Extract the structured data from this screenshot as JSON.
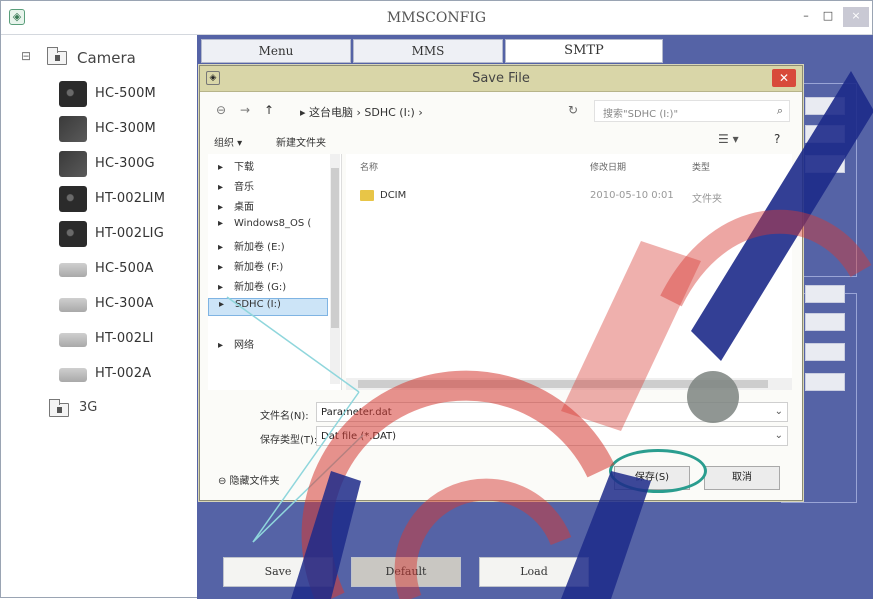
{
  "window": {
    "title": "MMSCONFIG",
    "icon": "app-icon",
    "min": "–",
    "max": "□",
    "close": "×"
  },
  "tree": {
    "root_label": "Camera",
    "root_expander": "⊟",
    "cameras": [
      {
        "label": "HC-500M",
        "thumb": "dark"
      },
      {
        "label": "HC-300M",
        "thumb": "mid"
      },
      {
        "label": "HC-300G",
        "thumb": "mid"
      },
      {
        "label": "HT-002LIM",
        "thumb": "dark"
      },
      {
        "label": "HT-002LIG",
        "thumb": "dark"
      },
      {
        "label": "HC-500A",
        "thumb": "pale"
      },
      {
        "label": "HC-300A",
        "thumb": "pale"
      },
      {
        "label": "HT-002LI",
        "thumb": "pale"
      },
      {
        "label": "HT-002A",
        "thumb": "pale"
      }
    ],
    "g3_label": "3G"
  },
  "tabs": [
    "Menu",
    "MMS",
    "SMTP"
  ],
  "bottom_buttons": [
    "Save",
    "Default",
    "Load"
  ],
  "dialog": {
    "title": "Save File",
    "address": {
      "back": "⊖",
      "forward": "→",
      "up": "↑",
      "crumbs": "▸ 这台电脑 › SDHC (I:) ›",
      "refresh": "↻",
      "search_placeholder": "搜索\"SDHC (I:)\"",
      "search_icon": "⌕"
    },
    "toolbar": {
      "organize": "组织 ▾",
      "new_folder": "新建文件夹",
      "views": "☰ ▾",
      "help": "?"
    },
    "nav_items": [
      {
        "label": "下载",
        "icon": "▸"
      },
      {
        "label": "音乐",
        "icon": "▸"
      },
      {
        "label": "桌面",
        "icon": "▸"
      },
      {
        "label": "Windows8_OS (",
        "icon": "▸"
      },
      {
        "label": "新加卷 (E:)",
        "icon": "▸"
      },
      {
        "label": "新加卷 (F:)",
        "icon": "▸"
      },
      {
        "label": "新加卷 (G:)",
        "icon": "▸"
      },
      {
        "label": "SDHC (I:)",
        "icon": "▸"
      },
      {
        "label": "网络",
        "icon": "▸"
      }
    ],
    "columns": {
      "name": "名称",
      "date": "修改日期",
      "type": "类型"
    },
    "files": [
      {
        "name": "DCIM",
        "date": "2010-05-10 0:01",
        "type": "文件夹"
      }
    ],
    "filename_label": "文件名(N):",
    "filename_value": "Parameter.dat",
    "filetype_label": "保存类型(T):",
    "filetype_value": "Dat file (*.DAT)",
    "hide_folders": "⊖ 隐藏文件夹",
    "save_button": "保存(S)",
    "cancel_button": "取消"
  },
  "colors": {
    "main_bg": "#5563a6",
    "dialog_title": "#d9d6a8",
    "ring": "#2a9d8f"
  }
}
